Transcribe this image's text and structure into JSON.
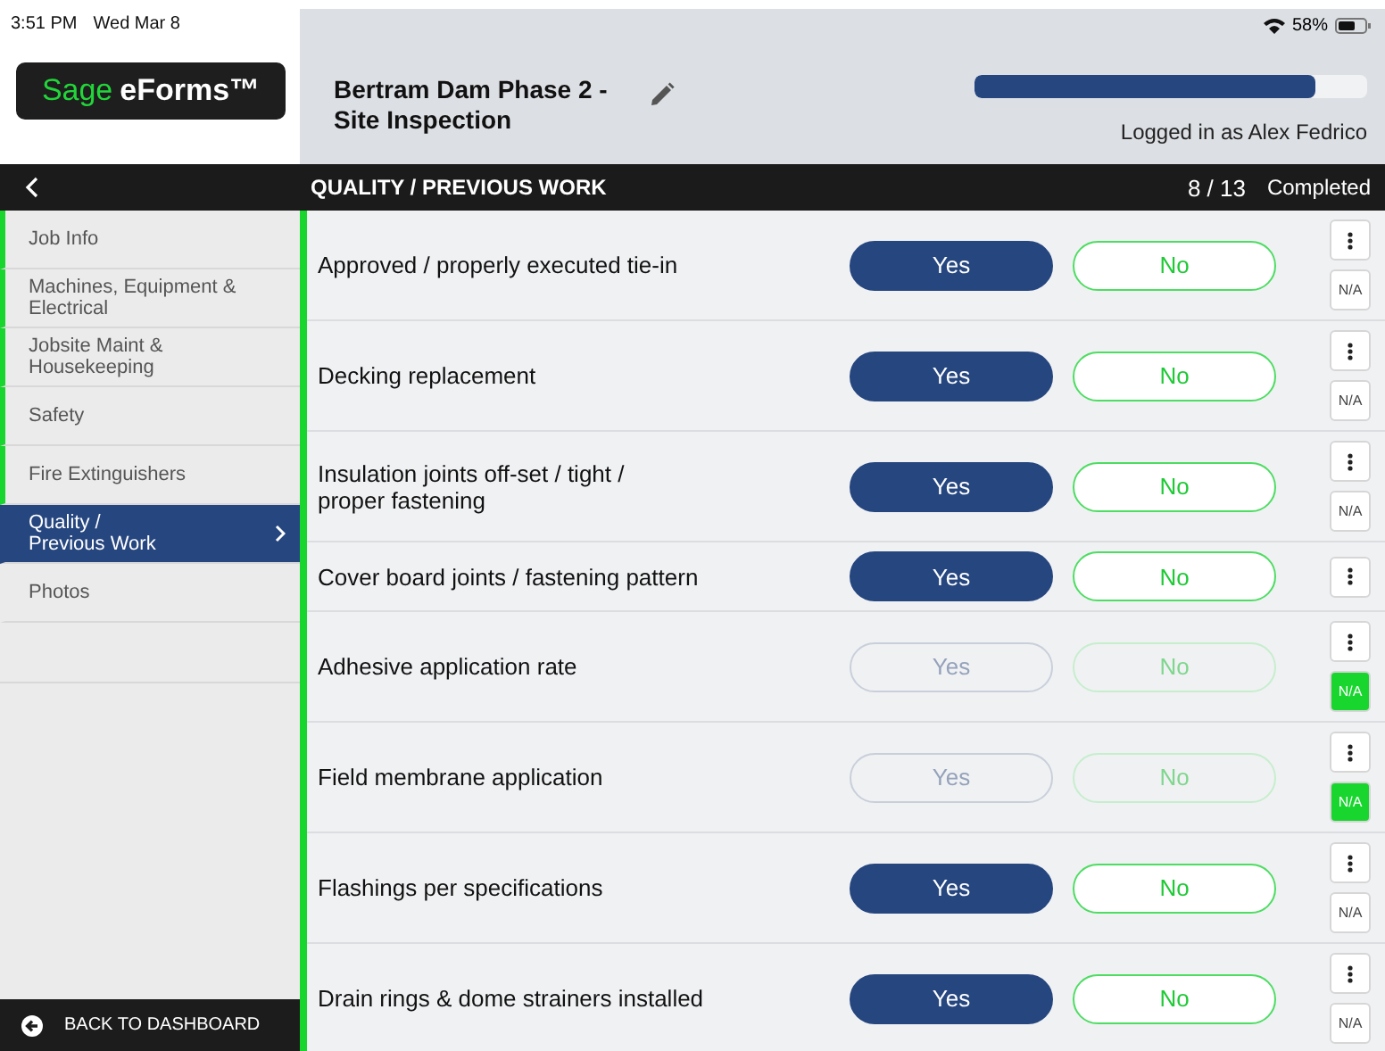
{
  "status_bar": {
    "time": "3:51 PM",
    "date": "Wed Mar 8",
    "battery": "58%"
  },
  "logo": {
    "brand": "Sage",
    "product": "eForms™"
  },
  "header": {
    "title": "Bertram Dam Phase 2 - Site Inspection",
    "progress": {
      "level": 0.87
    },
    "user": "Logged in as Alex Fedrico"
  },
  "section_bar": {
    "title": "QUALITY / PREVIOUS WORK",
    "count": "8 / 13",
    "status": "Completed"
  },
  "sidebar": {
    "items": [
      {
        "label": "Job Info",
        "completed": true,
        "selected": false
      },
      {
        "label": "Machines, Equipment & Electrical",
        "completed": true,
        "selected": false
      },
      {
        "label": "Jobsite Maint & Housekeeping",
        "completed": true,
        "selected": false
      },
      {
        "label": "Safety",
        "completed": true,
        "selected": false
      },
      {
        "label": "Fire Extinguishers",
        "completed": true,
        "selected": false
      },
      {
        "label": "Quality /\nPrevious Work",
        "completed": false,
        "selected": true
      },
      {
        "label": "Photos",
        "completed": false,
        "selected": false
      }
    ],
    "back_button": "BACK TO DASHBOARD"
  },
  "questions": [
    {
      "label": "Approved / properly executed tie-in",
      "yes": {
        "label": "Yes",
        "selected": true
      },
      "no": {
        "label": "No",
        "selected": false
      },
      "na": {
        "label": "N/A",
        "selected": false
      }
    },
    {
      "label": "Decking replacement",
      "yes": {
        "label": "Yes",
        "selected": true
      },
      "no": {
        "label": "No",
        "selected": false
      },
      "na": {
        "label": "N/A",
        "selected": false
      }
    },
    {
      "label": "Insulation joints off-set / tight /\nproper fastening",
      "yes": {
        "label": "Yes",
        "selected": true
      },
      "no": {
        "label": "No",
        "selected": false
      },
      "na": {
        "label": "N/A",
        "selected": false
      }
    },
    {
      "label": "Cover board joints / fastening pattern",
      "yes": {
        "label": "Yes",
        "selected": true
      },
      "no": {
        "label": "No",
        "selected": false
      }
    },
    {
      "label": "Adhesive application rate",
      "yes": {
        "label": "Yes",
        "selected": false
      },
      "no": {
        "label": "No",
        "selected": false
      },
      "na": {
        "label": "N/A",
        "selected": true
      }
    },
    {
      "label": "Field membrane application",
      "yes": {
        "label": "Yes",
        "selected": false
      },
      "no": {
        "label": "No",
        "selected": false
      },
      "na": {
        "label": "N/A",
        "selected": true
      }
    },
    {
      "label": "Flashings per specifications",
      "yes": {
        "label": "Yes",
        "selected": true
      },
      "no": {
        "label": "No",
        "selected": false
      },
      "na": {
        "label": "N/A",
        "selected": false
      }
    },
    {
      "label": "Drain rings & dome strainers installed",
      "yes": {
        "label": "Yes",
        "selected": true
      },
      "no": {
        "label": "No",
        "selected": false
      },
      "na": {
        "label": "N/A",
        "selected": false
      }
    }
  ]
}
